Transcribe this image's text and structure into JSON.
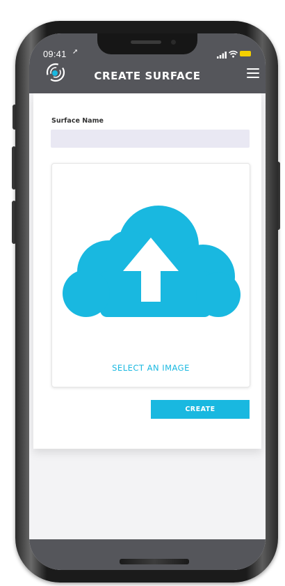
{
  "status_bar": {
    "time": "09:41",
    "location_arrow": "➚",
    "signal_icon": "signal-bars-icon",
    "wifi_icon": "wifi-icon",
    "battery_icon": "battery-icon",
    "battery_color": "#f5d000"
  },
  "header": {
    "title": "CREATE SURFACE",
    "logo_icon": "app-logo-icon",
    "menu_icon": "hamburger-menu-icon",
    "background_color": "#55565b"
  },
  "form": {
    "surface_name_label": "Surface Name",
    "surface_name_value": "",
    "upload": {
      "icon": "cloud-upload-icon",
      "label": "SELECT AN IMAGE"
    },
    "create_button_label": "CREATE"
  },
  "colors": {
    "accent": "#19b8e0",
    "input_background": "#e9e8f3"
  }
}
